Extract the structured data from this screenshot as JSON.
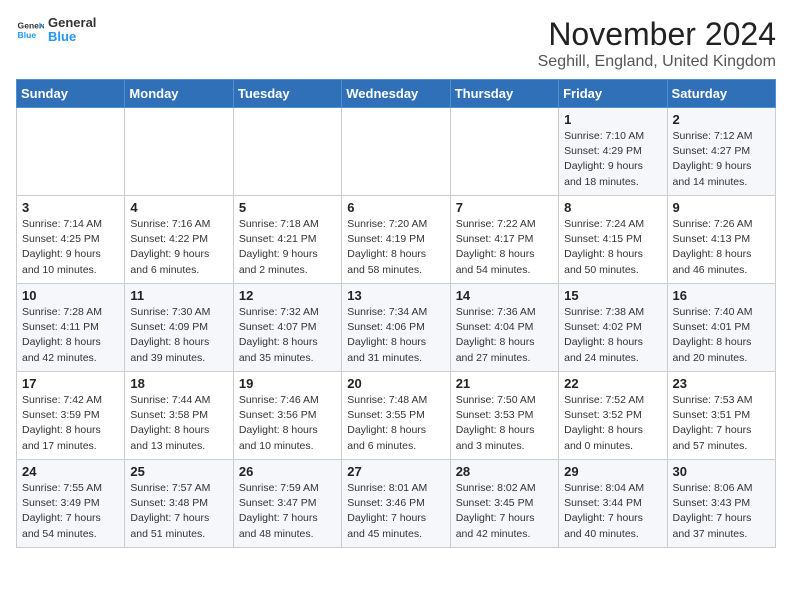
{
  "header": {
    "logo_general": "General",
    "logo_blue": "Blue",
    "title": "November 2024",
    "location": "Seghill, England, United Kingdom"
  },
  "days_of_week": [
    "Sunday",
    "Monday",
    "Tuesday",
    "Wednesday",
    "Thursday",
    "Friday",
    "Saturday"
  ],
  "weeks": [
    [
      {
        "day": "",
        "info": ""
      },
      {
        "day": "",
        "info": ""
      },
      {
        "day": "",
        "info": ""
      },
      {
        "day": "",
        "info": ""
      },
      {
        "day": "",
        "info": ""
      },
      {
        "day": "1",
        "info": "Sunrise: 7:10 AM\nSunset: 4:29 PM\nDaylight: 9 hours\nand 18 minutes."
      },
      {
        "day": "2",
        "info": "Sunrise: 7:12 AM\nSunset: 4:27 PM\nDaylight: 9 hours\nand 14 minutes."
      }
    ],
    [
      {
        "day": "3",
        "info": "Sunrise: 7:14 AM\nSunset: 4:25 PM\nDaylight: 9 hours\nand 10 minutes."
      },
      {
        "day": "4",
        "info": "Sunrise: 7:16 AM\nSunset: 4:22 PM\nDaylight: 9 hours\nand 6 minutes."
      },
      {
        "day": "5",
        "info": "Sunrise: 7:18 AM\nSunset: 4:21 PM\nDaylight: 9 hours\nand 2 minutes."
      },
      {
        "day": "6",
        "info": "Sunrise: 7:20 AM\nSunset: 4:19 PM\nDaylight: 8 hours\nand 58 minutes."
      },
      {
        "day": "7",
        "info": "Sunrise: 7:22 AM\nSunset: 4:17 PM\nDaylight: 8 hours\nand 54 minutes."
      },
      {
        "day": "8",
        "info": "Sunrise: 7:24 AM\nSunset: 4:15 PM\nDaylight: 8 hours\nand 50 minutes."
      },
      {
        "day": "9",
        "info": "Sunrise: 7:26 AM\nSunset: 4:13 PM\nDaylight: 8 hours\nand 46 minutes."
      }
    ],
    [
      {
        "day": "10",
        "info": "Sunrise: 7:28 AM\nSunset: 4:11 PM\nDaylight: 8 hours\nand 42 minutes."
      },
      {
        "day": "11",
        "info": "Sunrise: 7:30 AM\nSunset: 4:09 PM\nDaylight: 8 hours\nand 39 minutes."
      },
      {
        "day": "12",
        "info": "Sunrise: 7:32 AM\nSunset: 4:07 PM\nDaylight: 8 hours\nand 35 minutes."
      },
      {
        "day": "13",
        "info": "Sunrise: 7:34 AM\nSunset: 4:06 PM\nDaylight: 8 hours\nand 31 minutes."
      },
      {
        "day": "14",
        "info": "Sunrise: 7:36 AM\nSunset: 4:04 PM\nDaylight: 8 hours\nand 27 minutes."
      },
      {
        "day": "15",
        "info": "Sunrise: 7:38 AM\nSunset: 4:02 PM\nDaylight: 8 hours\nand 24 minutes."
      },
      {
        "day": "16",
        "info": "Sunrise: 7:40 AM\nSunset: 4:01 PM\nDaylight: 8 hours\nand 20 minutes."
      }
    ],
    [
      {
        "day": "17",
        "info": "Sunrise: 7:42 AM\nSunset: 3:59 PM\nDaylight: 8 hours\nand 17 minutes."
      },
      {
        "day": "18",
        "info": "Sunrise: 7:44 AM\nSunset: 3:58 PM\nDaylight: 8 hours\nand 13 minutes."
      },
      {
        "day": "19",
        "info": "Sunrise: 7:46 AM\nSunset: 3:56 PM\nDaylight: 8 hours\nand 10 minutes."
      },
      {
        "day": "20",
        "info": "Sunrise: 7:48 AM\nSunset: 3:55 PM\nDaylight: 8 hours\nand 6 minutes."
      },
      {
        "day": "21",
        "info": "Sunrise: 7:50 AM\nSunset: 3:53 PM\nDaylight: 8 hours\nand 3 minutes."
      },
      {
        "day": "22",
        "info": "Sunrise: 7:52 AM\nSunset: 3:52 PM\nDaylight: 8 hours\nand 0 minutes."
      },
      {
        "day": "23",
        "info": "Sunrise: 7:53 AM\nSunset: 3:51 PM\nDaylight: 7 hours\nand 57 minutes."
      }
    ],
    [
      {
        "day": "24",
        "info": "Sunrise: 7:55 AM\nSunset: 3:49 PM\nDaylight: 7 hours\nand 54 minutes."
      },
      {
        "day": "25",
        "info": "Sunrise: 7:57 AM\nSunset: 3:48 PM\nDaylight: 7 hours\nand 51 minutes."
      },
      {
        "day": "26",
        "info": "Sunrise: 7:59 AM\nSunset: 3:47 PM\nDaylight: 7 hours\nand 48 minutes."
      },
      {
        "day": "27",
        "info": "Sunrise: 8:01 AM\nSunset: 3:46 PM\nDaylight: 7 hours\nand 45 minutes."
      },
      {
        "day": "28",
        "info": "Sunrise: 8:02 AM\nSunset: 3:45 PM\nDaylight: 7 hours\nand 42 minutes."
      },
      {
        "day": "29",
        "info": "Sunrise: 8:04 AM\nSunset: 3:44 PM\nDaylight: 7 hours\nand 40 minutes."
      },
      {
        "day": "30",
        "info": "Sunrise: 8:06 AM\nSunset: 3:43 PM\nDaylight: 7 hours\nand 37 minutes."
      }
    ]
  ]
}
